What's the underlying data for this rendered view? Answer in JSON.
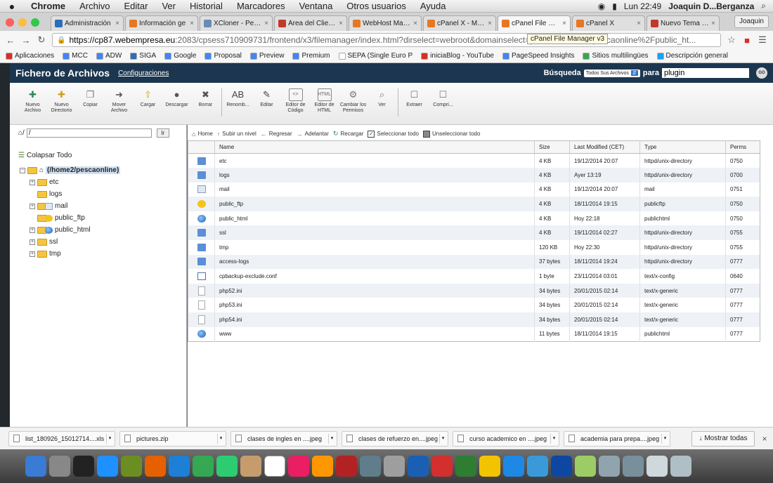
{
  "menubar": {
    "apple": "",
    "items": [
      "Chrome",
      "Archivo",
      "Editar",
      "Ver",
      "Historial",
      "Marcadores",
      "Ventana",
      "Otros usuarios",
      "Ayuda"
    ],
    "clock": "Lun 22:49",
    "user": "Joaquin D...Berganza"
  },
  "browser": {
    "tabs": [
      {
        "label": "Administración",
        "color": "#2a6fb8"
      },
      {
        "label": "Información ge",
        "color": "#e87722"
      },
      {
        "label": "XCloner - Pesca",
        "color": "#6b8ab5"
      },
      {
        "label": "Área del Cliente",
        "color": "#c0392b"
      },
      {
        "label": "WebHost Manag",
        "color": "#e87722"
      },
      {
        "label": "cPanel X - Main",
        "color": "#e87722"
      },
      {
        "label": "cPanel File Man",
        "color": "#e87722"
      },
      {
        "label": "cPanel X",
        "color": "#e87722"
      },
      {
        "label": "Nuevo Tema - H",
        "color": "#c0392b"
      }
    ],
    "profile": "Joaquin",
    "url_host": "https://cp87.webempresa.eu",
    "url_path": ":2083/cpsess710909731/frontend/x3/filemanager/index.html?dirselect=webroot&domainselect=pescaon",
    "url_tail": "e2%2Fpescaonline%2Fpublic_ht...",
    "tooltip": "cPanel File Manager v3",
    "bookmarks": [
      {
        "label": "Aplicaciones",
        "color": "#d93025"
      },
      {
        "label": "MCC",
        "color": "#4285f4"
      },
      {
        "label": "ADW",
        "color": "#4285f4"
      },
      {
        "label": "SIGA",
        "color": "#2a6fb8"
      },
      {
        "label": "Google",
        "color": "#4285f4"
      },
      {
        "label": "Proposal",
        "color": "#4285f4"
      },
      {
        "label": "Preview",
        "color": "#4285f4"
      },
      {
        "label": "Premium",
        "color": "#4285f4"
      },
      {
        "label": "SEPA (Single Euro P",
        "color": "#ffffff"
      },
      {
        "label": "iniciaBlog - YouTube",
        "color": "#d93025"
      },
      {
        "label": "PageSpeed Insights",
        "color": "#4285f4"
      },
      {
        "label": "Sitios multilingües",
        "color": "#34a853"
      },
      {
        "label": "Descripción general",
        "color": "#1da1f2"
      }
    ]
  },
  "cpanel": {
    "title": "Fichero de Archivos",
    "config": "Configuraciones",
    "search_label": "Búsqueda",
    "search_scope": "Todos Sus Archivos",
    "search_for": "para",
    "search_value": "plugin",
    "go": "GO",
    "toolbar": [
      {
        "label": "Nuevo Archivo",
        "icon": "new-file-icon"
      },
      {
        "label": "Nuevo Directorio",
        "icon": "new-folder-icon"
      },
      {
        "label": "Copiar",
        "icon": "copy-icon"
      },
      {
        "label": "Mover Archivo",
        "icon": "move-icon"
      },
      {
        "label": "Cargar",
        "icon": "upload-icon"
      },
      {
        "label": "Descargar",
        "icon": "download-icon"
      },
      {
        "label": "Borrar",
        "icon": "delete-icon"
      },
      {
        "label": "Renomb...",
        "icon": "rename-icon"
      },
      {
        "label": "Editar",
        "icon": "edit-icon"
      },
      {
        "label": "Editor de Código",
        "icon": "code-editor-icon"
      },
      {
        "label": "Editor de HTML",
        "icon": "html-editor-icon"
      },
      {
        "label": "Cambiar los Permisos",
        "icon": "permissions-icon"
      },
      {
        "label": "Ver",
        "icon": "view-icon"
      },
      {
        "label": "Extraer",
        "icon": "extract-icon"
      },
      {
        "label": "Compri...",
        "icon": "compress-icon"
      }
    ],
    "path_value": "/",
    "go_path": "Ir",
    "collapse": "Colapsar Todo",
    "tree_root": "(/home2/pescaonline)",
    "tree": [
      "etc",
      "logs",
      "mail",
      "public_ftp",
      "public_html",
      "ssl",
      "tmp"
    ],
    "nav_actions": [
      "Home",
      "Subir un nivel",
      "Regresar",
      "Adelantar",
      "Recargar",
      "Seleccionar todo",
      "Unseleccionar todo"
    ],
    "columns": [
      "Name",
      "Size",
      "Last Modified (CET)",
      "Type",
      "Perms"
    ],
    "files": [
      {
        "icon": "dir",
        "name": "etc",
        "size": "4 KB",
        "modified": "19/12/2014 20:07",
        "type": "httpd/unix-directory",
        "perms": "0750"
      },
      {
        "icon": "dir",
        "name": "logs",
        "size": "4 KB",
        "modified": "Ayer 13:19",
        "type": "httpd/unix-directory",
        "perms": "0700"
      },
      {
        "icon": "mail",
        "name": "mail",
        "size": "4 KB",
        "modified": "19/12/2014 20:07",
        "type": "mail",
        "perms": "0751"
      },
      {
        "icon": "ftp",
        "name": "public_ftp",
        "size": "4 KB",
        "modified": "18/11/2014 19:15",
        "type": "publicftp",
        "perms": "0750"
      },
      {
        "icon": "globe",
        "name": "public_html",
        "size": "4 KB",
        "modified": "Hoy 22:18",
        "type": "publichtml",
        "perms": "0750"
      },
      {
        "icon": "dir",
        "name": "ssl",
        "size": "4 KB",
        "modified": "19/11/2014 02:27",
        "type": "httpd/unix-directory",
        "perms": "0755"
      },
      {
        "icon": "dir",
        "name": "tmp",
        "size": "120 KB",
        "modified": "Hoy 22:30",
        "type": "httpd/unix-directory",
        "perms": "0755"
      },
      {
        "icon": "dir",
        "name": "access-logs",
        "size": "37 bytes",
        "modified": "18/11/2014 19:24",
        "type": "httpd/unix-directory",
        "perms": "0777"
      },
      {
        "icon": "conf",
        "name": "cpbackup-exclude.conf",
        "size": "1 byte",
        "modified": "23/11/2014 03:01",
        "type": "text/x-config",
        "perms": "0640"
      },
      {
        "icon": "text",
        "name": "php52.ini",
        "size": "34 bytes",
        "modified": "20/01/2015 02:14",
        "type": "text/x-generic",
        "perms": "0777"
      },
      {
        "icon": "text",
        "name": "php53.ini",
        "size": "34 bytes",
        "modified": "20/01/2015 02:14",
        "type": "text/x-generic",
        "perms": "0777"
      },
      {
        "icon": "text",
        "name": "php54.ini",
        "size": "34 bytes",
        "modified": "20/01/2015 02:14",
        "type": "text/x-generic",
        "perms": "0777"
      },
      {
        "icon": "globe",
        "name": "www",
        "size": "11 bytes",
        "modified": "18/11/2014 19:15",
        "type": "publichtml",
        "perms": "0777"
      }
    ]
  },
  "downloads": {
    "items": [
      "list_180926_15012714....xls",
      "pictures.zip",
      "clases de ingles en ....jpeg",
      "clases de refuerzo en....jpeg",
      "curso academico en ....jpeg",
      "academia para prepa....jpeg"
    ],
    "show_all": "Mostrar todas"
  },
  "dock": {
    "colors": [
      "#3a7bd5",
      "#888888",
      "#222222",
      "#1e90ff",
      "#6b8e23",
      "#e66000",
      "#1e7fd6",
      "#34a853",
      "#2ecc71",
      "#c69c6d",
      "#ffffff",
      "#e91e63",
      "#ff9800",
      "#b22222",
      "#607d8b",
      "#9e9e9e",
      "#1a5fb4",
      "#d32f2f",
      "#2e7d32",
      "#f2c300",
      "#1e88e5",
      "#3a9ad9",
      "#0d47a1",
      "#9ccc65",
      "#90a4ae",
      "#78909c",
      "#cfd8dc",
      "#b0bec5"
    ]
  }
}
